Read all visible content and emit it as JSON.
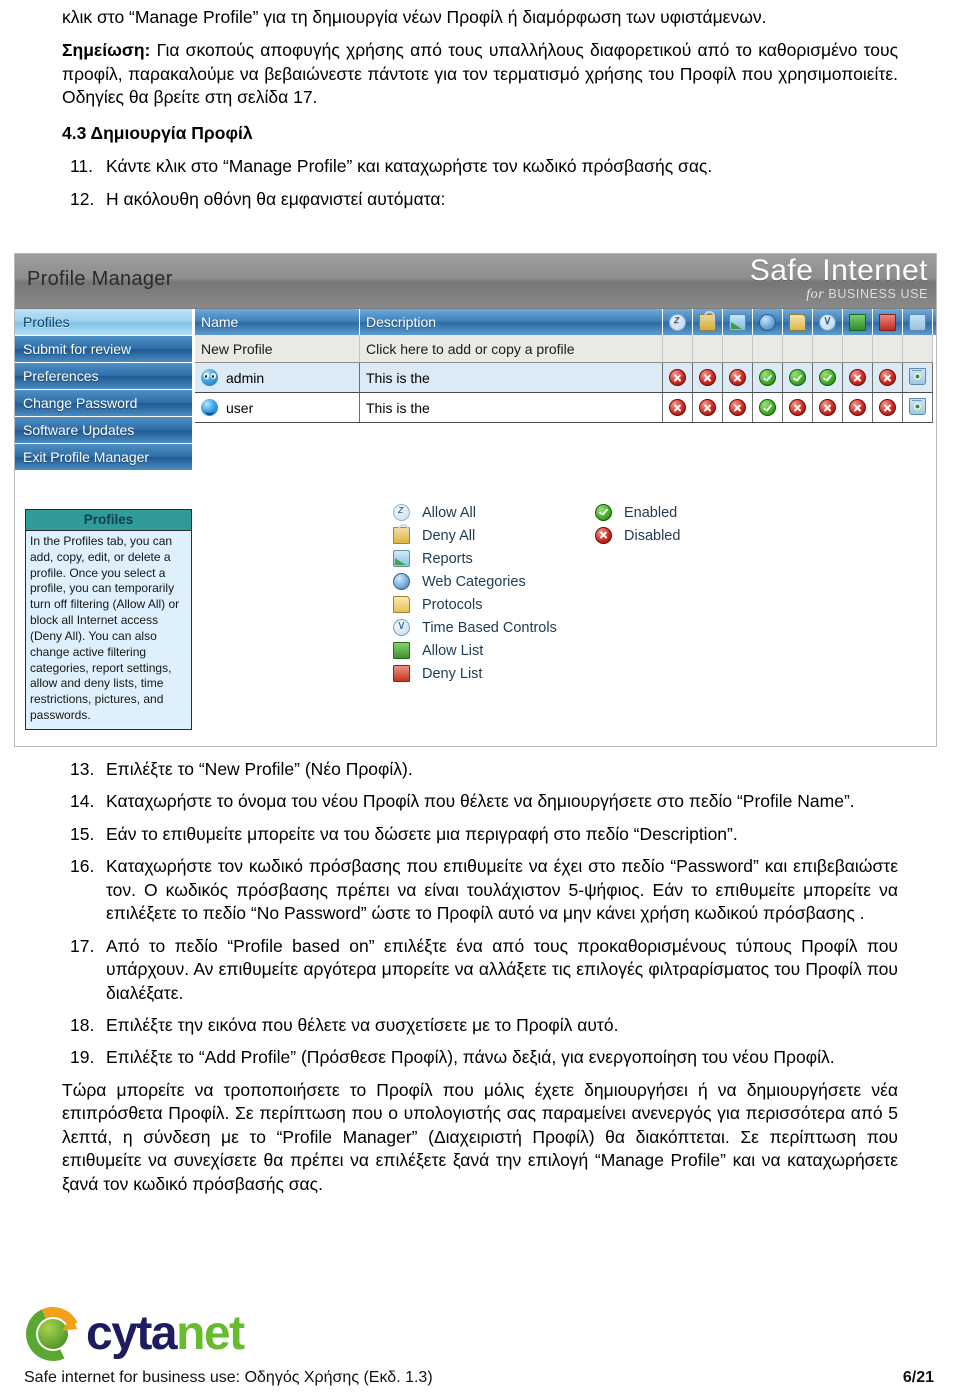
{
  "document": {
    "intro_continued": "κλικ στο “Manage Profile” για τη δημιουργία νέων Προφίλ ή διαμόρφωση των υφιστάμενων.",
    "note_label": "Σημείωση:",
    "note_text": " Για σκοπούς αποφυγής χρήσης από τους υπαλλήλους διαφορετικού από το καθορισμένο τους προφίλ, παρακαλούμε να βεβαιώνεστε πάντοτε για τον τερματισμό χρήσης του Προφίλ που χρησιμοποιείτε. Οδηγίες θα βρείτε στη σελίδα 17.",
    "section_heading": "4.3 Δημιουργία Προφίλ",
    "steps_top": [
      {
        "num": "11.",
        "text": "Κάντε κλικ στο “Manage Profile” και καταχωρήστε τον κωδικό πρόσβασής σας."
      },
      {
        "num": "12.",
        "text": "Η ακόλουθη οθόνη θα εμφανιστεί αυτόματα:"
      }
    ],
    "steps_bottom": [
      {
        "num": "13.",
        "text": "Επιλέξτε το “New Profile” (Νέο Προφίλ)."
      },
      {
        "num": "14.",
        "text": "Καταχωρήστε το όνομα του νέου Προφίλ που θέλετε να δημιουργήσετε στο πεδίο “Profile Name”."
      },
      {
        "num": "15.",
        "text": "Εάν το επιθυμείτε μπορείτε να του δώσετε μια περιγραφή στο πεδίο “Description”."
      },
      {
        "num": "16.",
        "text": "Καταχωρήστε τον κωδικό πρόσβασης που επιθυμείτε να έχει στο πεδίο “Password” και επιβεβαιώστε τον. Ο κωδικός πρόσβασης πρέπει να είναι τουλάχιστον 5-ψήφιος. Εάν το επιθυμείτε μπορείτε να επιλέξετε το πεδίο “No Password” ώστε το Προφίλ αυτό να μην κάνει χρήση κωδικού πρόσβασης ."
      },
      {
        "num": "17.",
        "text": "Από το πεδίο “Profile based on” επιλέξτε ένα από τους προκαθορισμένους τύπους Προφίλ που υπάρχουν. Αν επιθυμείτε αργότερα μπορείτε να αλλάξετε τις επιλογές φιλτραρίσματος του Προφίλ που διαλέξατε."
      },
      {
        "num": "18.",
        "text": "Επιλέξτε την εικόνα που θέλετε να συσχετίσετε με το Προφίλ αυτό."
      },
      {
        "num": "19.",
        "text": "Επιλέξτε το “Add Profile” (Πρόσθεσε Προφίλ), πάνω δεξιά, για ενεργοποίηση του νέου Προφίλ."
      }
    ],
    "closing_paragraph": "Τώρα μπορείτε να τροποποιήσετε το Προφίλ που μόλις έχετε δημιουργήσει ή να δημιουργήσετε νέα επιπρόσθετα Προφίλ. Σε περίπτωση που ο υπολογιστής σας παραμείνει ανενεργός για περισσότερα από 5 λεπτά, η σύνδεση με το “Profile Manager” (Διαχειριστή Προφίλ) θα διακόπτεται. Σε περίπτωση που επιθυμείτε να συνεχίσετε θα πρέπει να επιλέξετε ξανά την επιλογή “Manage Profile” και να καταχωρήσετε ξανά τον κωδικό πρόσβασής σας."
  },
  "screenshot": {
    "title": "Profile Manager",
    "brand": {
      "main": "Safe Internet",
      "for_word": "for",
      "sub": "BUSINESS USE"
    },
    "nav_items": [
      {
        "label": "Profiles",
        "active": true
      },
      {
        "label": "Submit for review",
        "active": false
      },
      {
        "label": "Preferences",
        "active": false
      },
      {
        "label": "Change Password",
        "active": false
      },
      {
        "label": "Software Updates",
        "active": false
      },
      {
        "label": "Exit Profile Manager",
        "active": false
      }
    ],
    "infobox": {
      "title": "Profiles",
      "text": "In the Profiles tab, you can add, copy, edit, or delete a profile. Once you select a profile, you can temporarily turn off filtering (Allow All) or block all Internet access (Deny All). You can also change active filtering categories, report settings, allow and deny lists, time restrictions, pictures, and passwords."
    },
    "table": {
      "columns": [
        "Name",
        "Description"
      ],
      "icon_columns": [
        "allow-all-icon",
        "deny-all-icon",
        "reports-icon",
        "web-categories-icon",
        "protocols-icon",
        "time-based-controls-icon",
        "allow-list-icon",
        "deny-list-icon",
        "delete-icon"
      ],
      "rows": [
        {
          "name": "New Profile",
          "description": "Click here to add or copy a profile",
          "avatar": "none",
          "statuses": [
            "",
            "",
            "",
            "",
            "",
            "",
            "",
            "",
            ""
          ]
        },
        {
          "name": "admin",
          "description": "This is the",
          "avatar": "admin",
          "statuses": [
            "no",
            "no",
            "no",
            "ok",
            "ok",
            "ok",
            "no",
            "no",
            "trash"
          ]
        },
        {
          "name": "user",
          "description": "This is the",
          "avatar": "user",
          "statuses": [
            "no",
            "no",
            "no",
            "ok",
            "no",
            "no",
            "no",
            "no",
            "trash"
          ]
        }
      ]
    },
    "legend": [
      {
        "icon": "allow-all-icon",
        "label": "Allow All"
      },
      {
        "icon": "deny-all-icon",
        "label": "Deny All"
      },
      {
        "icon": "reports-icon",
        "label": "Reports"
      },
      {
        "icon": "web-categories-icon",
        "label": "Web Categories"
      },
      {
        "icon": "protocols-icon",
        "label": "Protocols"
      },
      {
        "icon": "time-based-controls-icon",
        "label": "Time Based Controls"
      },
      {
        "icon": "allow-list-icon",
        "label": "Allow List"
      },
      {
        "icon": "deny-list-icon",
        "label": "Deny List"
      }
    ],
    "legend_status": [
      {
        "icon": "enabled-icon",
        "label": "Enabled"
      },
      {
        "icon": "disabled-icon",
        "label": "Disabled"
      }
    ]
  },
  "footer": {
    "logo_part1": "cyta",
    "logo_part2": "net",
    "text": "Safe internet for business use: Οδηγός Χρήσης (Εκδ. 1.3)",
    "page": "6/21"
  }
}
